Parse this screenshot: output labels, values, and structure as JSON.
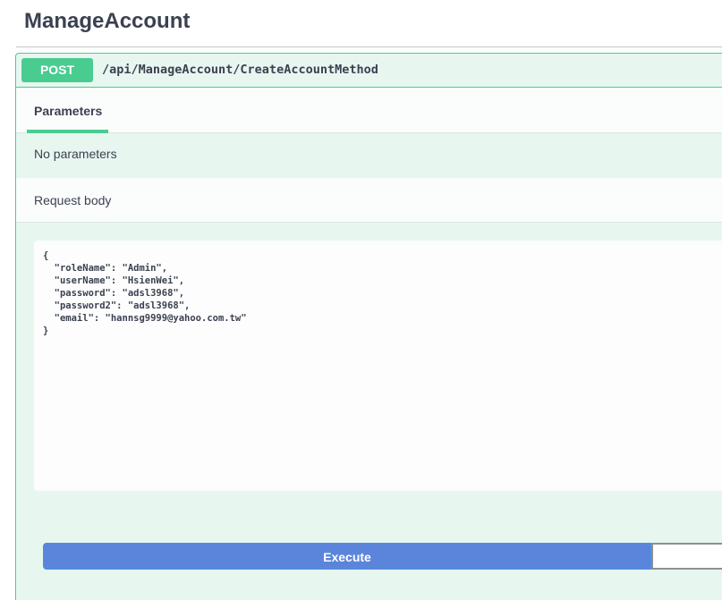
{
  "tag": {
    "title": "ManageAccount"
  },
  "operation": {
    "method": "POST",
    "path": "/api/ManageAccount/CreateAccountMethod"
  },
  "tabs": {
    "parameters_label": "Parameters"
  },
  "parameters": {
    "empty_text": "No parameters"
  },
  "request_body": {
    "label": "Request body",
    "content": "{\n  \"roleName\": \"Admin\",\n  \"userName\": \"HsienWei\",\n  \"password\": \"adsl3968\",\n  \"password2\": \"adsl3968\",\n  \"email\": \"hannsg9999@yahoo.com.tw\"\n}"
  },
  "actions": {
    "execute_label": "Execute",
    "clear_label": ""
  },
  "colors": {
    "post_accent": "#49cc90",
    "execute_blue": "#5b85db",
    "text_dark": "#3b4151"
  }
}
